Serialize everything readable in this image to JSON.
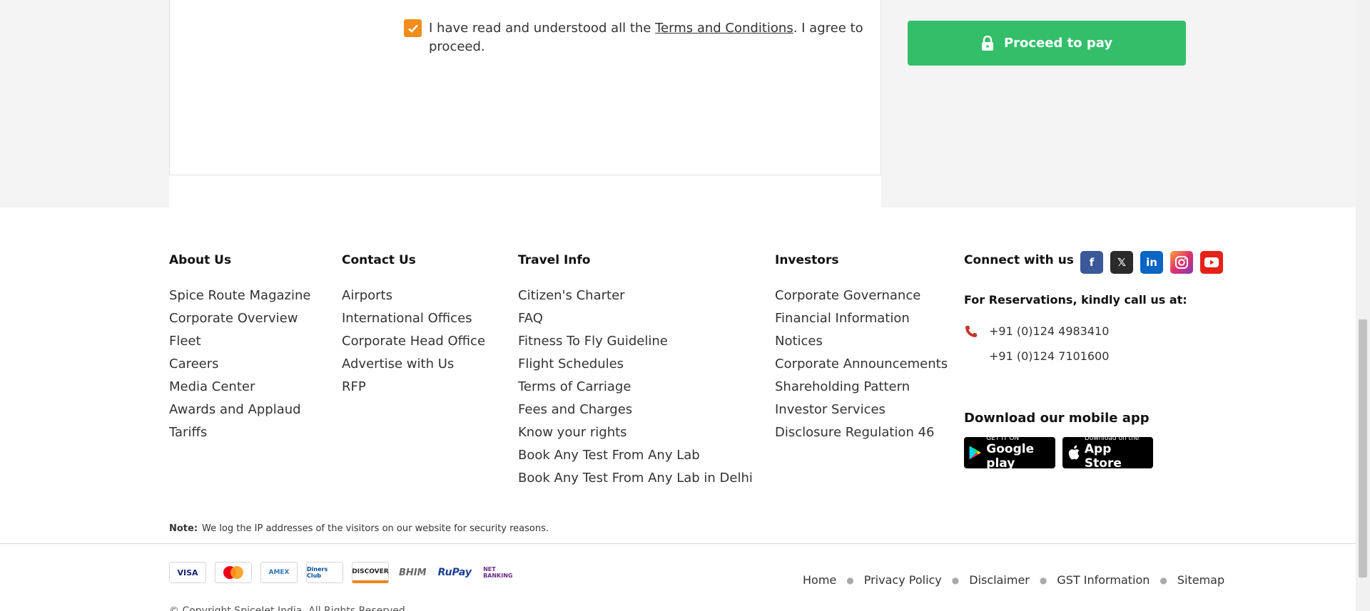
{
  "terms": {
    "text_before": "I have read and understood all the ",
    "link": "Terms and Conditions",
    "text_after": ". I agree to proceed."
  },
  "pay_button": {
    "label": "Proceed to pay"
  },
  "footer": {
    "about": {
      "title": "About Us",
      "items": [
        "Spice Route Magazine",
        "Corporate Overview",
        "Fleet",
        "Careers",
        "Media Center",
        "Awards and Applaud",
        "Tariffs"
      ]
    },
    "contact": {
      "title": "Contact Us",
      "items": [
        "Airports",
        "International Offices",
        "Corporate Head Office",
        "Advertise with Us",
        "RFP"
      ]
    },
    "travel": {
      "title": "Travel Info",
      "items": [
        "Citizen's Charter",
        "FAQ",
        "Fitness To Fly Guideline",
        "Flight Schedules",
        "Terms of Carriage",
        "Fees and Charges",
        "Know your rights",
        "Book Any Test From Any Lab",
        "Book Any Test From Any Lab in Delhi"
      ]
    },
    "investors": {
      "title": "Investors",
      "items": [
        "Corporate Governance",
        "Financial Information",
        "Notices",
        "Corporate Announcements",
        "Shareholding Pattern",
        "Investor Services",
        "Disclosure Regulation 46"
      ]
    },
    "connect": {
      "title": "Connect with us",
      "socials": [
        "facebook-icon",
        "x-icon",
        "linkedin-icon",
        "instagram-icon",
        "youtube-icon"
      ],
      "reservations": "For Reservations, kindly call us at:",
      "phone1": "+91 (0)124 4983410",
      "phone2": "+91 (0)124 7101600",
      "app_title": "Download our mobile app",
      "google_small": "GET IT ON",
      "google_big": "Google play",
      "apple_small": "Download on the",
      "apple_big": "App Store"
    },
    "note_label": "Note:",
    "note_text": "We log the IP addresses of the visitors on our website for security reasons.",
    "payment_methods": [
      "VISA",
      "MasterCard",
      "AMEX",
      "Diners Club",
      "DISCOVER",
      "BHIM",
      "RuPay",
      "NET BANKING"
    ],
    "bottom_links": [
      "Home",
      "Privacy Policy",
      "Disclaimer",
      "GST Information",
      "Sitemap"
    ],
    "copyright": "© Copyright SpiceJet India. All Rights Reserved."
  },
  "colors": {
    "accent_orange": "#f28d1c",
    "pay_green": "#33bf6a"
  }
}
